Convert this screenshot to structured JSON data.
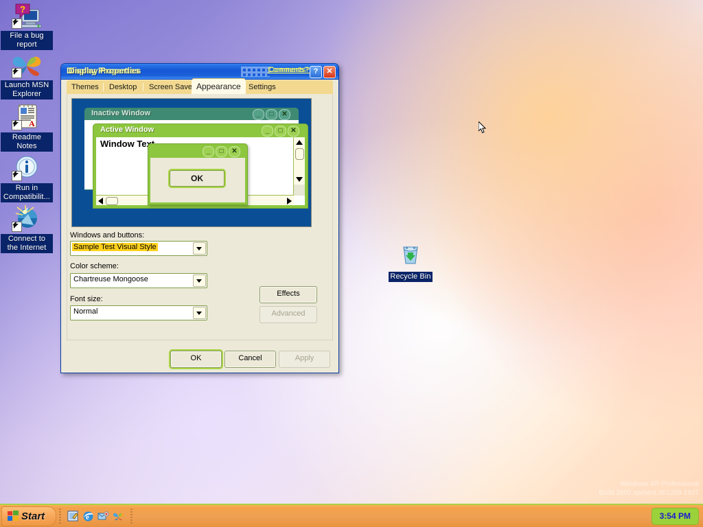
{
  "desktop": {
    "icons": [
      {
        "label": "File a bug report",
        "icon": "bug-report-icon"
      },
      {
        "label": "Launch MSN Explorer",
        "icon": "msn-butterfly-icon"
      },
      {
        "label": "Readme Notes",
        "icon": "notepad-icon"
      },
      {
        "label": "Run in Compatibilit...",
        "icon": "info-icon"
      },
      {
        "label": "Connect to the Internet",
        "icon": "globe-icon"
      }
    ],
    "recycle_bin": {
      "label": "Recycle Bin",
      "icon": "recycle-bin-icon"
    },
    "watermark": [
      "Windows XP Professional",
      "Build 2600.xpclient.001208-1937"
    ]
  },
  "window": {
    "title": "Display Properties",
    "comments_link": "Comments?",
    "help_button": "?",
    "close_button": "✕",
    "tabs": [
      {
        "label": "Themes",
        "selected": false
      },
      {
        "label": "Desktop",
        "selected": false
      },
      {
        "label": "Screen Saver",
        "selected": false
      },
      {
        "label": "Appearance",
        "selected": true
      },
      {
        "label": "Settings",
        "selected": false
      }
    ]
  },
  "preview": {
    "inactive_window_title": "Inactive Window",
    "active_window_title": "Active Window",
    "window_text": "Window Text",
    "message_box_ok": "OK",
    "caption_buttons": {
      "minimize": "_",
      "maximize": "□",
      "close": "✕"
    },
    "colors": {
      "preview_background": "#0a4f96",
      "active_caption": "#8dc63f",
      "inactive_caption": "#3f8a72",
      "window_background": "#ffffff",
      "button_face": "#ece9d8",
      "scrollbar_track": "#fdfbe8"
    }
  },
  "appearance": {
    "windows_and_buttons_label": "Windows and buttons:",
    "windows_and_buttons_value": "Sample Test Visual Style",
    "color_scheme_label": "Color scheme:",
    "color_scheme_value": "Chartreuse Mongoose",
    "font_size_label": "Font size:",
    "font_size_value": "Normal",
    "effects_button": "Effects",
    "advanced_button": "Advanced"
  },
  "dialog_buttons": {
    "ok": "OK",
    "cancel": "Cancel",
    "apply": "Apply"
  },
  "taskbar": {
    "start_label": "Start",
    "clock": "3:54 PM",
    "quick_launch": [
      "show-desktop-icon",
      "internet-explorer-icon",
      "outlook-express-icon",
      "msn-butterfly-icon"
    ]
  }
}
